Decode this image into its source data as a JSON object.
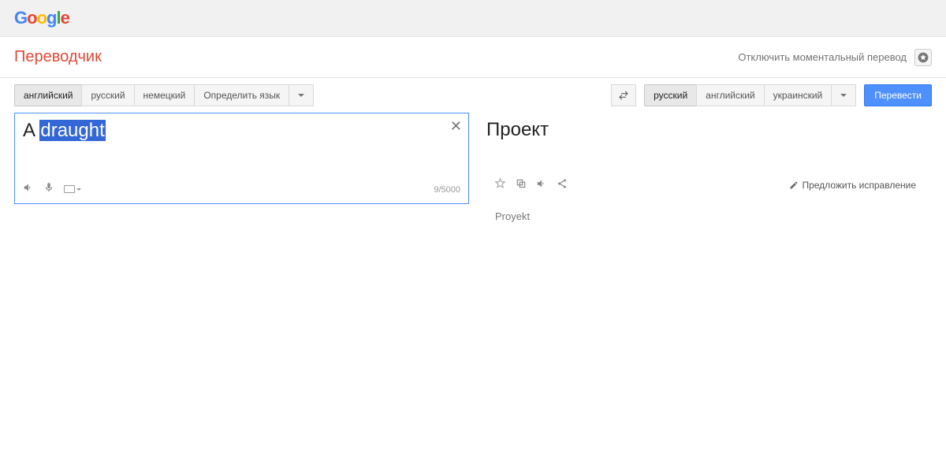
{
  "header": {
    "logo": [
      "G",
      "o",
      "o",
      "g",
      "l",
      "e"
    ]
  },
  "titlebar": {
    "app_title": "Переводчик",
    "disable_instant": "Отключить моментальный перевод"
  },
  "source_langs": {
    "items": [
      "английский",
      "русский",
      "немецкий",
      "Определить язык"
    ],
    "active_index": 0
  },
  "target_langs": {
    "items": [
      "русский",
      "английский",
      "украинский"
    ],
    "active_index": 0
  },
  "actions": {
    "translate": "Перевести",
    "suggest_fix": "Предложить исправление"
  },
  "source": {
    "text_prefix": "A ",
    "text_highlight": "draught",
    "char_count": "9/5000"
  },
  "result": {
    "text": "Проект",
    "transliteration": "Proyekt"
  }
}
